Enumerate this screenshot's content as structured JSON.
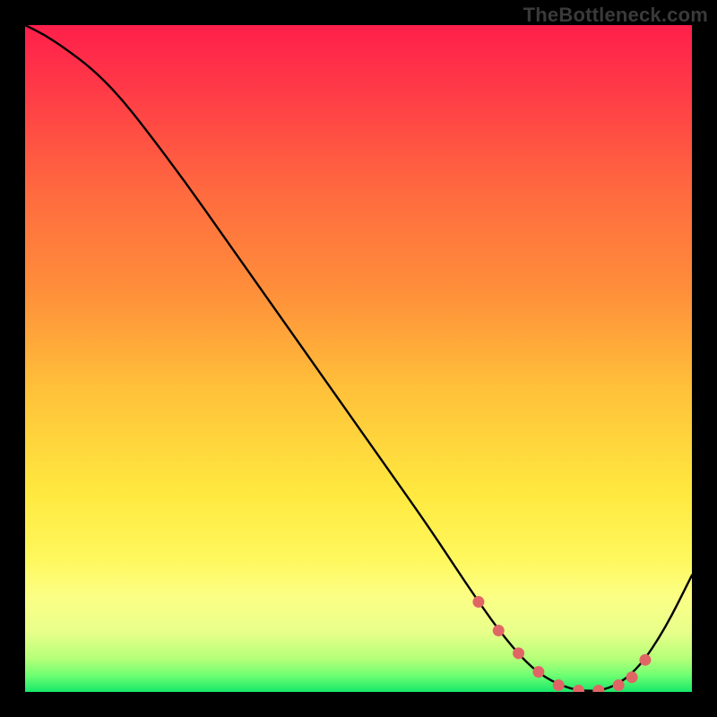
{
  "watermark": "TheBottleneck.com",
  "colors": {
    "frame": "#000000",
    "curve": "#000000",
    "marker": "#e06666",
    "gradient": [
      {
        "offset": 0.0,
        "color": "#ff1f4b"
      },
      {
        "offset": 0.1,
        "color": "#ff3b47"
      },
      {
        "offset": 0.25,
        "color": "#ff6a3f"
      },
      {
        "offset": 0.4,
        "color": "#ff8f3a"
      },
      {
        "offset": 0.55,
        "color": "#ffc23a"
      },
      {
        "offset": 0.7,
        "color": "#ffe83f"
      },
      {
        "offset": 0.8,
        "color": "#fff85d"
      },
      {
        "offset": 0.86,
        "color": "#fbff86"
      },
      {
        "offset": 0.91,
        "color": "#e8ff8a"
      },
      {
        "offset": 0.95,
        "color": "#b6ff79"
      },
      {
        "offset": 0.975,
        "color": "#6fff72"
      },
      {
        "offset": 1.0,
        "color": "#17e86a"
      }
    ]
  },
  "chart_data": {
    "type": "line",
    "title": "",
    "xlabel": "",
    "ylabel": "",
    "xlim": [
      0,
      100
    ],
    "ylim": [
      0,
      100
    ],
    "grid": false,
    "legend": false,
    "series": [
      {
        "name": "curve",
        "x": [
          0,
          3,
          6,
          10,
          14,
          18,
          24,
          30,
          36,
          42,
          48,
          54,
          60,
          64,
          68,
          72,
          76,
          80,
          84,
          88,
          92,
          96,
          100
        ],
        "y": [
          100,
          98.5,
          96.5,
          93.5,
          89.5,
          84.5,
          76.5,
          68,
          59.5,
          51,
          42.5,
          34,
          25.5,
          19.5,
          13.5,
          8.0,
          3.5,
          1.0,
          0.0,
          0.5,
          3.5,
          9.5,
          17.5
        ]
      }
    ],
    "markers": {
      "name": "highlight",
      "x": [
        68,
        71,
        74,
        77,
        80,
        83,
        86,
        89,
        91,
        93
      ],
      "y": [
        13.5,
        9.2,
        5.8,
        3.0,
        1.0,
        0.2,
        0.2,
        1.0,
        2.2,
        4.8
      ]
    }
  }
}
